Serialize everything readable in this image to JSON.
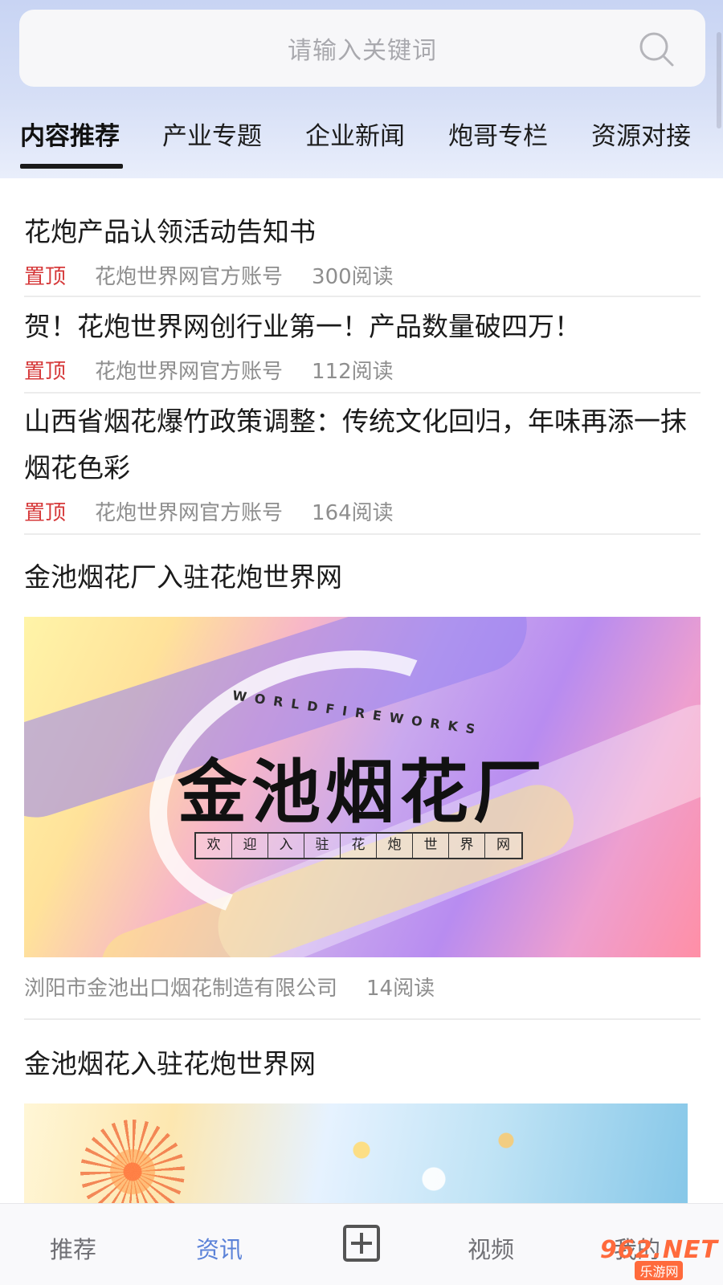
{
  "search": {
    "placeholder": "请输入关键词"
  },
  "tabs": [
    {
      "label": "内容推荐"
    },
    {
      "label": "产业专题"
    },
    {
      "label": "企业新闻"
    },
    {
      "label": "炮哥专栏"
    },
    {
      "label": "资源对接"
    }
  ],
  "feed": {
    "items": [
      {
        "title": "花炮产品认领活动告知书",
        "pin": "置顶",
        "source": "花炮世界网官方账号",
        "reads": "300阅读"
      },
      {
        "title": "贺！花炮世界网创行业第一！产品数量破四万！",
        "pin": "置顶",
        "source": "花炮世界网官方账号",
        "reads": "112阅读"
      },
      {
        "title": "山西省烟花爆竹政策调整：传统文化回归，年味再添一抹烟花色彩",
        "pin": "置顶",
        "source": "花炮世界网官方账号",
        "reads": "164阅读"
      },
      {
        "title": "金池烟花厂入驻花炮世界网",
        "source": "浏阳市金池出口烟花制造有限公司",
        "reads": "14阅读",
        "banner": {
          "world": "WORLDFIREWORKS",
          "main": "金池烟花厂",
          "welcome": [
            "欢",
            "迎",
            "入",
            "驻",
            "花",
            "炮",
            "世",
            "界",
            "网"
          ]
        }
      },
      {
        "title": "金池烟花入驻花炮世界网"
      }
    ]
  },
  "tabbar": {
    "items": [
      {
        "label": "推荐"
      },
      {
        "label": "资讯"
      },
      {
        "label": "视频"
      },
      {
        "label": "我的"
      }
    ],
    "active_color": "#5b82d8"
  },
  "watermark": {
    "text": "962.NET",
    "sub": "乐游网"
  }
}
